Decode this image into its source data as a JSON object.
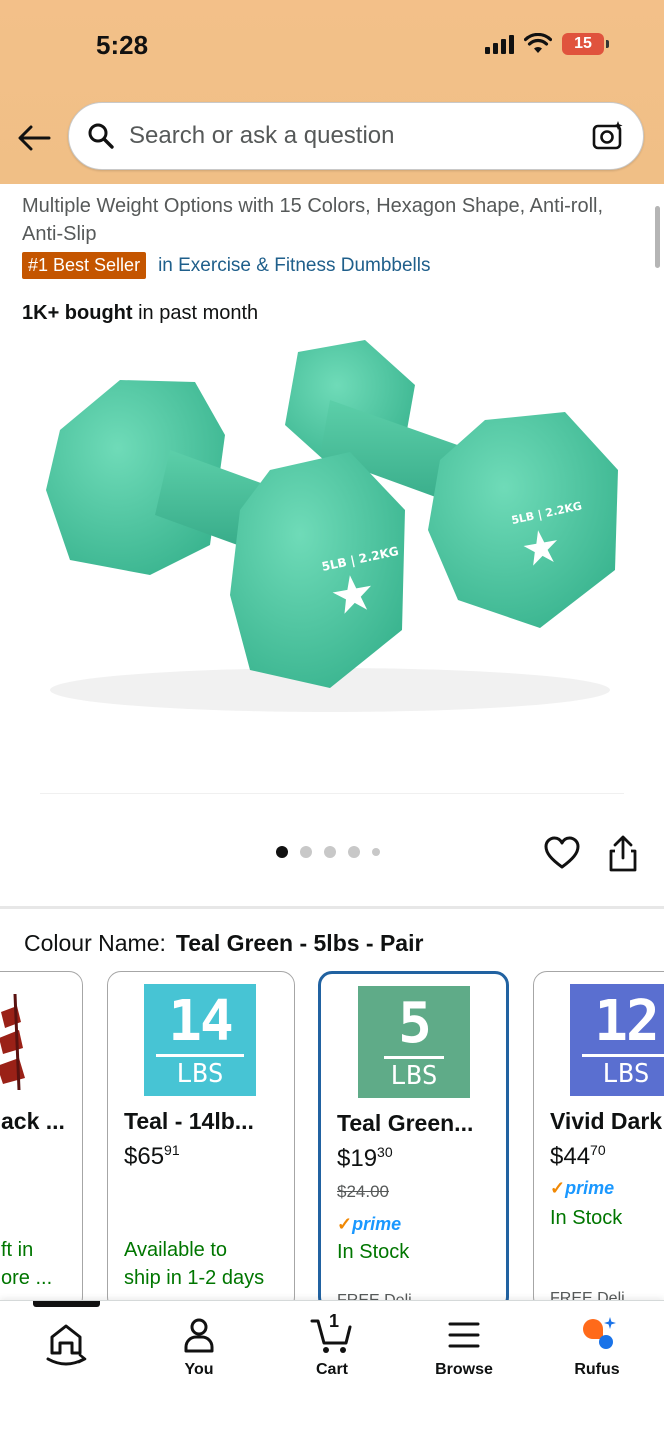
{
  "status_bar": {
    "time": "5:28",
    "battery": "15"
  },
  "search": {
    "placeholder": "Search or ask a question"
  },
  "product": {
    "title_fragment": "Multiple Weight Options with 15 Colors, Hexagon Shape, Anti-roll, Anti-Slip",
    "badge": "#1 Best Seller",
    "category_link": "in Exercise & Fitness Dumbbells",
    "bought_strong": "1K+ bought",
    "bought_rest": " in past month",
    "image_label": "5LB | 2.2KG",
    "image_color": "#4fc9a3"
  },
  "gallery": {
    "dot_count": 5,
    "active_index": 0
  },
  "colour": {
    "label": "Colour Name:",
    "value": "Teal Green - 5lbs - Pair"
  },
  "swatches": [
    {
      "name": "ack ...",
      "price_main": "",
      "price_cents": "",
      "stock_line1": "ft in",
      "stock_line2": "ore ...",
      "color": "#a0221a"
    },
    {
      "name": "Teal - 14lb...",
      "price_main": "$65",
      "price_cents": "91",
      "stock_line1": "Available to",
      "stock_line2": "ship in 1-2 days",
      "img_num": "14",
      "img_unit": "LBS",
      "color": "#47c4d4"
    },
    {
      "name": "Teal Green...",
      "price_main": "$19",
      "price_cents": "30",
      "strike": "$24.00",
      "prime": "prime",
      "stock_line1": "In Stock",
      "faded": "FREE Deli...",
      "img_num": "5",
      "img_unit": "LBS",
      "color": "#5fab88"
    },
    {
      "name": "Vivid Dark",
      "price_main": "$44",
      "price_cents": "70",
      "prime": "prime",
      "stock_line1": "In Stock",
      "faded": "FREE Deli...",
      "img_num": "12",
      "img_unit": "LBS",
      "color": "#5a6fd0"
    }
  ],
  "nav": {
    "home_label": "",
    "you_label": "You",
    "cart_label": "Cart",
    "cart_count": "1",
    "browse_label": "Browse",
    "rufus_label": "Rufus"
  },
  "colors": {
    "header_bg": "#f3c089",
    "bestseller_bg": "#c45500",
    "link": "#1f5f8b",
    "selected_border": "#2162a1",
    "in_stock": "#007600"
  }
}
